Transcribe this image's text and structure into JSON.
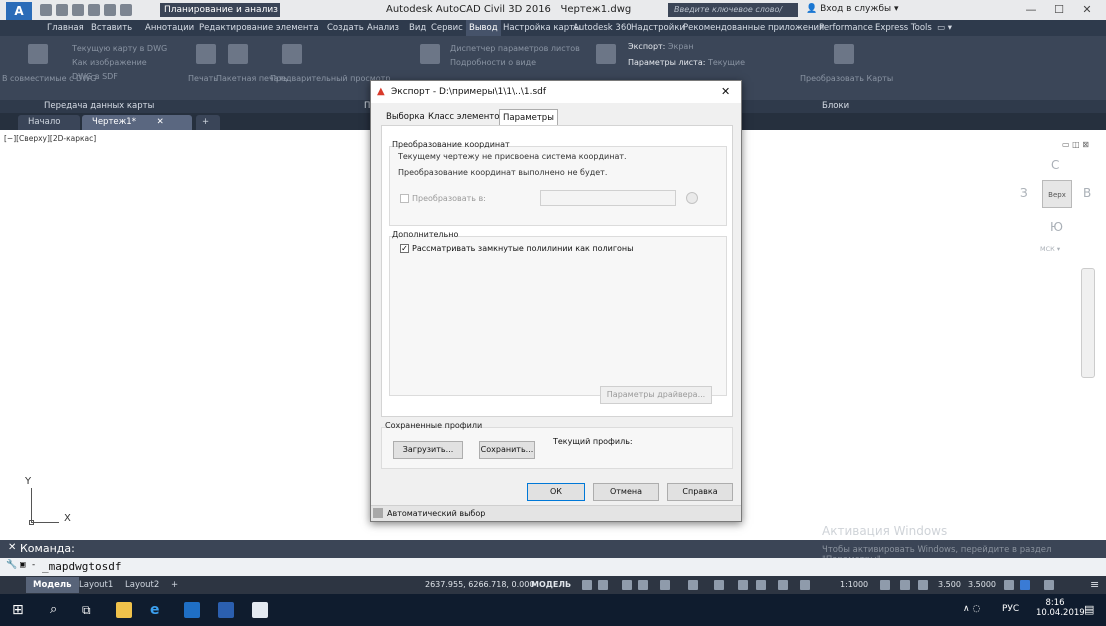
{
  "title_bar": {
    "workspace": "Планирование и анализ",
    "app_title": "Autodesk AutoCAD Civil 3D 2016",
    "doc_name": "Чертеж1.dwg",
    "search_placeholder": "Введите ключевое слово/фразу",
    "signin": "Вход в службы"
  },
  "ribbon_tabs": [
    "Главная",
    "Вставить",
    "Аннотации",
    "Редактирование элемента",
    "Создать",
    "Анализ",
    "Вид",
    "Сервис",
    "Вывод",
    "Настройка карты",
    "Autodesk 360",
    "Надстройки",
    "Рекомендованные приложения",
    "Performance",
    "Express Tools"
  ],
  "ribbon_active_tab": "Вывод",
  "ribbon": {
    "items": [
      "Текущую карту в DWG",
      "Как изображение",
      "Печать",
      "Пакетная печать",
      "Предварительный просмотр",
      "Диспетчер параметров листов",
      "Подробности о виде",
      "Экспорт:",
      "Экран",
      "Параметры листа:",
      "Текущие",
      "Преобразовать Карты",
      "В совместимые с DWG",
      "DWG в SDF"
    ],
    "panel_labels": [
      "Передача данных карты",
      "Пе",
      "Блоки"
    ]
  },
  "doc_tabs": [
    "Начало",
    "Чертеж1*"
  ],
  "viewport_label": "[−][Сверху][2D-каркас]",
  "viewcube": {
    "top": "Верх",
    "north": "С",
    "south": "Ю",
    "west": "З",
    "east": "В",
    "wcs": "МСК"
  },
  "ucs": {
    "x": "X",
    "y": "Y"
  },
  "dialog": {
    "title": "Экспорт - D:\\примеры\\1\\1\\..\\1.sdf",
    "tabs": [
      "Выборка",
      "Класс элементов",
      "Параметры"
    ],
    "active_tab": "Параметры",
    "coord_group": "Преобразование координат",
    "coord_line1": "Текущему чертежу не присвоена система координат.",
    "coord_line2": "Преобразование координат выполнено не будет.",
    "convert_to": "Преобразовать в:",
    "extra_group": "Дополнительно",
    "treat_polylines": "Рассматривать замкнутые полилинии как полигоны",
    "driver_params": "Параметры драйвера...",
    "profiles_group": "Сохраненные профили",
    "current_profile": "Текущий профиль:",
    "load": "Загрузить...",
    "save": "Сохранить...",
    "ok": "ОК",
    "cancel": "Отмена",
    "help": "Справка",
    "auto_select": "Автоматический выбор"
  },
  "command": {
    "label": "Команда:",
    "history": "_mapdwgtosdf"
  },
  "status": {
    "layouts": [
      "Модель",
      "Layout1",
      "Layout2"
    ],
    "coords": "2637.955, 6266.718, 0.000",
    "space": "МОДЕЛЬ",
    "scale": "1:1000",
    "v1": "3.500",
    "v2": "3.5000"
  },
  "watermark": {
    "line1": "Активация Windows",
    "line2": "Чтобы активировать Windows, перейдите в раздел \"Параметры\"."
  },
  "taskbar": {
    "lang": "РУС",
    "time": "8:16",
    "date": "10.04.2019"
  }
}
